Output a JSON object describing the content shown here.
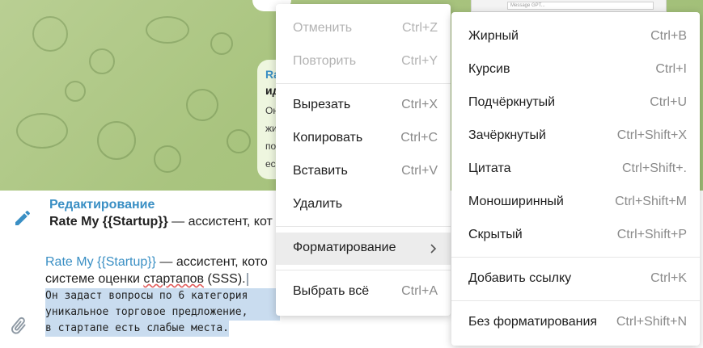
{
  "editing": {
    "title": "Редактирование",
    "preview_bold": "Rate My {{Startup}}",
    "preview_rest": " — ассистент, кот"
  },
  "message": {
    "line1_link": "Rate My {{Startup}}",
    "line1_rest": " — ассистент, кото",
    "line2_before": "системе оценки ",
    "line2_squiggle": "стартапов",
    "line2_after": " (SSS).",
    "mono_lines": [
      "Он задаст вопросы по 6 категория",
      "уникальное торговое предложение,",
      "в стартапе есть слабые места."
    ]
  },
  "bubble": {
    "title": "Ra",
    "line": "ид",
    "lines": [
      "Он",
      "жи",
      "по",
      "ес"
    ]
  },
  "mini_window": {
    "field": "Message GPT..."
  },
  "edit_menu": {
    "items": [
      {
        "label": "Отменить",
        "shortcut": "Ctrl+Z"
      },
      {
        "label": "Повторить",
        "shortcut": "Ctrl+Y"
      },
      {
        "label": "Вырезать",
        "shortcut": "Ctrl+X"
      },
      {
        "label": "Копировать",
        "shortcut": "Ctrl+C"
      },
      {
        "label": "Вставить",
        "shortcut": "Ctrl+V"
      },
      {
        "label": "Удалить",
        "shortcut": ""
      },
      {
        "label": "Форматирование",
        "shortcut": ""
      },
      {
        "label": "Выбрать всё",
        "shortcut": "Ctrl+A"
      }
    ]
  },
  "format_menu": {
    "items": [
      {
        "label": "Жирный",
        "shortcut": "Ctrl+B"
      },
      {
        "label": "Курсив",
        "shortcut": "Ctrl+I"
      },
      {
        "label": "Подчёркнутый",
        "shortcut": "Ctrl+U"
      },
      {
        "label": "Зачёркнутый",
        "shortcut": "Ctrl+Shift+X"
      },
      {
        "label": "Цитата",
        "shortcut": "Ctrl+Shift+."
      },
      {
        "label": "Моноширинный",
        "shortcut": "Ctrl+Shift+M"
      },
      {
        "label": "Скрытый",
        "shortcut": "Ctrl+Shift+P"
      },
      {
        "label": "Добавить ссылку",
        "shortcut": "Ctrl+K"
      },
      {
        "label": "Без форматирования",
        "shortcut": "Ctrl+Shift+N"
      }
    ]
  },
  "colors": {
    "accent": "#3a8fc4",
    "chat_background": "#a9c47f",
    "selection": "#c9dcef",
    "menu_hover": "#ececec"
  }
}
